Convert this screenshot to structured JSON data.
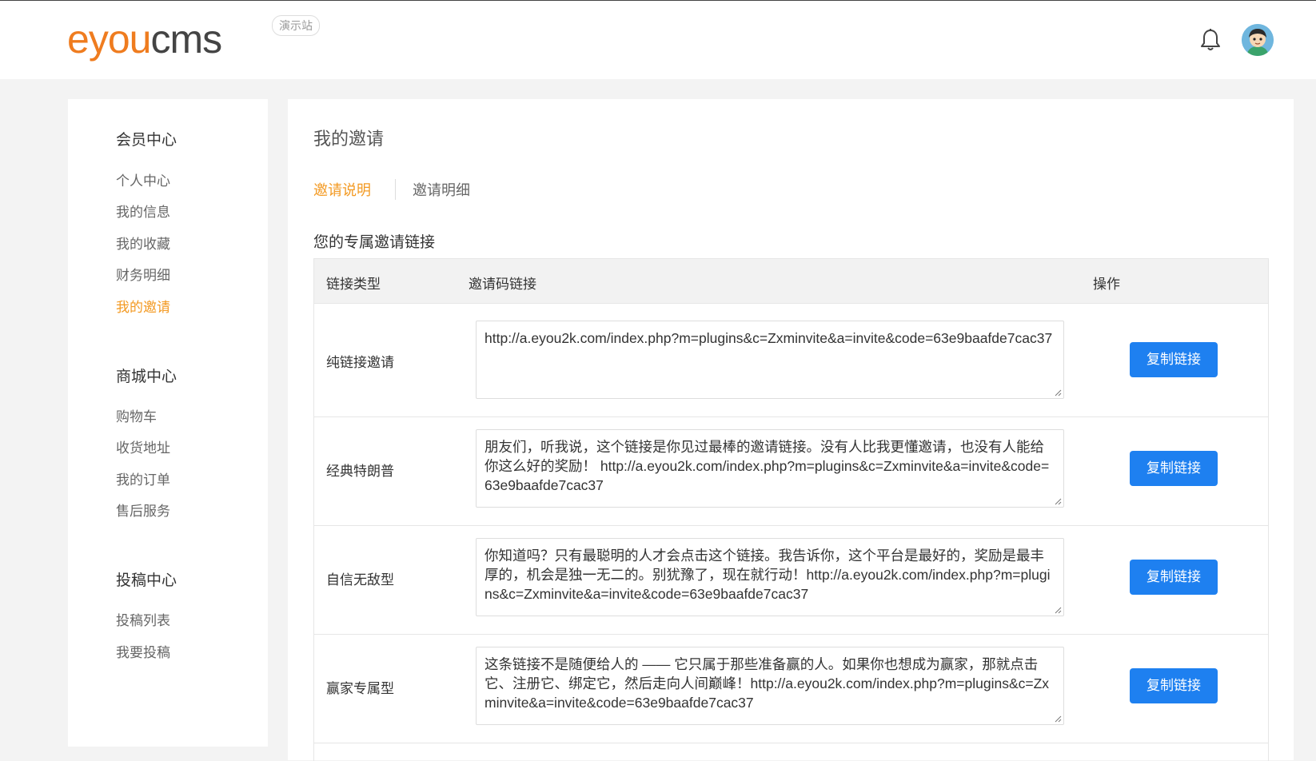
{
  "header": {
    "logo_e": "e",
    "logo_you": "you",
    "logo_cms": "cms",
    "demo_badge": "演示站",
    "bell_icon": "bell-icon",
    "avatar_icon": "user-avatar"
  },
  "sidebar": {
    "groups": [
      {
        "title": "会员中心",
        "items": [
          "个人中心",
          "我的信息",
          "我的收藏",
          "财务明细",
          "我的邀请"
        ]
      },
      {
        "title": "商城中心",
        "items": [
          "购物车",
          "收货地址",
          "我的订单",
          "售后服务"
        ]
      },
      {
        "title": "投稿中心",
        "items": [
          "投稿列表",
          "我要投稿"
        ]
      }
    ],
    "active_item": "我的邀请"
  },
  "main": {
    "title": "我的邀请",
    "tabs": [
      {
        "label": "邀请说明",
        "active": true
      },
      {
        "label": "邀请明细",
        "active": false
      }
    ],
    "section_title": "您的专属邀请链接",
    "table": {
      "headers": [
        "链接类型",
        "邀请码链接",
        "操作"
      ],
      "rows": [
        {
          "type": "纯链接邀请",
          "link": "http://a.eyou2k.com/index.php?m=plugins&c=Zxminvite&a=invite&code=63e9baafde7cac37",
          "action": "复制链接"
        },
        {
          "type": "经典特朗普",
          "link": "朋友们，听我说，这个链接是你见过最棒的邀请链接。没有人比我更懂邀请，也没有人能给你这么好的奖励！ http://a.eyou2k.com/index.php?m=plugins&c=Zxminvite&a=invite&code=63e9baafde7cac37",
          "action": "复制链接"
        },
        {
          "type": "自信无敌型",
          "link": "你知道吗？只有最聪明的人才会点击这个链接。我告诉你，这个平台是最好的，奖励是最丰厚的，机会是独一无二的。别犹豫了，现在就行动！http://a.eyou2k.com/index.php?m=plugins&c=Zxminvite&a=invite&code=63e9baafde7cac37",
          "action": "复制链接"
        },
        {
          "type": "赢家专属型",
          "link": "这条链接不是随便给人的 —— 它只属于那些准备赢的人。如果你也想成为赢家，那就点击它、注册它、绑定它，然后走向人间巅峰！http://a.eyou2k.com/index.php?m=plugins&c=Zxminvite&a=invite&code=63e9baafde7cac37",
          "action": "复制链接"
        }
      ]
    }
  },
  "colors": {
    "accent": "#f39a23",
    "button": "#1e80f0",
    "logo_orange": "#ef7c1f"
  }
}
